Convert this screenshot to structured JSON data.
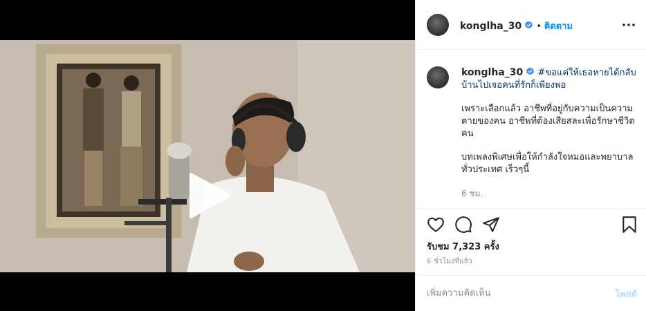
{
  "post": {
    "username": "konglha_30",
    "follow_label": "ติดตาม",
    "separator": "•",
    "caption": {
      "hashtag": "#ขอแค่ให้เธอหายได้กลับบ้านไปเจอคนที่รักก็เพียงพอ",
      "paragraph_1": "เพราะเลือกแล้ว อาชีพที่อยู่กับความเป็นความตายของคน อาชีพที่ต้องเสียสละเพื่อรักษาชีวิตคน",
      "paragraph_2": "บทเพลงพิเศษเพื่อให้กำลังใจหมอและพยาบาลทั่วประเทศ เร็วๆนี้",
      "time": "6 ชม."
    },
    "views": "รับชม 7,323 ครั้ง",
    "posted_ago": "6 ชั่วโมงที่แล้ว",
    "comment": {
      "placeholder": "เพิ่มความคิดเห็น",
      "post_label": "โพสต์"
    }
  },
  "colors": {
    "accent": "#0095f6",
    "hashtag": "#00376b",
    "muted": "#8e8e8e",
    "post_disabled": "#b2dffc"
  },
  "icons": [
    "play-icon",
    "verified-badge-icon",
    "more-options-icon",
    "heart-icon",
    "comment-icon",
    "share-icon",
    "bookmark-icon"
  ]
}
